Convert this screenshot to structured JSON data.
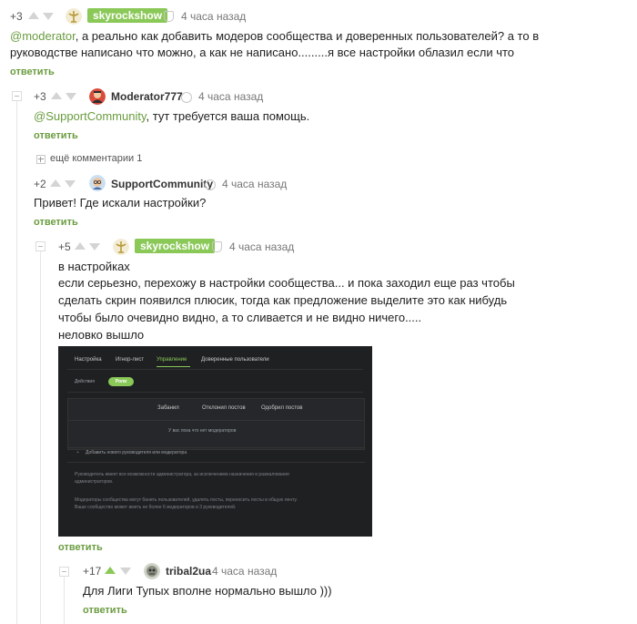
{
  "comments": [
    {
      "rating": "+3",
      "user": "skyrockshow",
      "time": "4 часа назад",
      "mention": "@moderator",
      "line1_rest": ", а реально как добавить модеров сообщества и доверенных пользователей? а то в",
      "line2": "руководстве написано что можно, а как не написано.........я все настройки облазил если что",
      "reply": "ответить"
    },
    {
      "rating": "+3",
      "user": "Moderator777",
      "time": "4 часа назад",
      "mention": "@SupportCommunity",
      "text_rest": ", тут требуется ваша помощь.",
      "reply": "ответить"
    },
    {
      "more": "ещё комментарии 1"
    },
    {
      "rating": "+2",
      "user": "SupportCommunity",
      "time": "4 часа назад",
      "text": "Привет! Где искали настройки?",
      "reply": "ответить"
    },
    {
      "rating": "+5",
      "user": "skyrockshow",
      "time": "4 часа назад",
      "lines": [
        "в настройках",
        "если серьезно, перехожу в настройки сообщества... и пока заходил еще раз чтобы",
        "сделать скрин появился плюсик, тогда как предложение выделите это как нибудь",
        "чтобы было очевидно видно, а то сливается и не видно ничего.....",
        "неловко вышло"
      ],
      "reply": "ответить"
    },
    {
      "rating": "+17",
      "user": "tribal2ua",
      "time": "4 часа назад",
      "text": "Для Лиги Тупых вполне нормально вышло )))",
      "reply": "ответить"
    }
  ],
  "screenshot": {
    "tabs": [
      "Настройка",
      "Игнор-лист",
      "Управление",
      "Доверенные пользователи"
    ],
    "subtabs": [
      "Действия",
      "Роли"
    ],
    "columns": [
      "Забанил",
      "Отклонил постов",
      "Одобрил постов"
    ],
    "empty": "У вас пока что нет модераторов",
    "add": "Добавить нового руководителя или модератора",
    "note1a": "Руководитель имеет все возможности администратора, за исключением назначения и разжалования",
    "note1b": "администраторов.",
    "note2a": "Модераторы сообщества могут банить пользователей, удалять посты, переносить посты в общую ленту.",
    "note2b": "Ваше сообщество может иметь не более 6 модераторов и 3 руководителей."
  },
  "colors": {
    "accent": "#8ac858",
    "link": "#6a9c3f"
  }
}
